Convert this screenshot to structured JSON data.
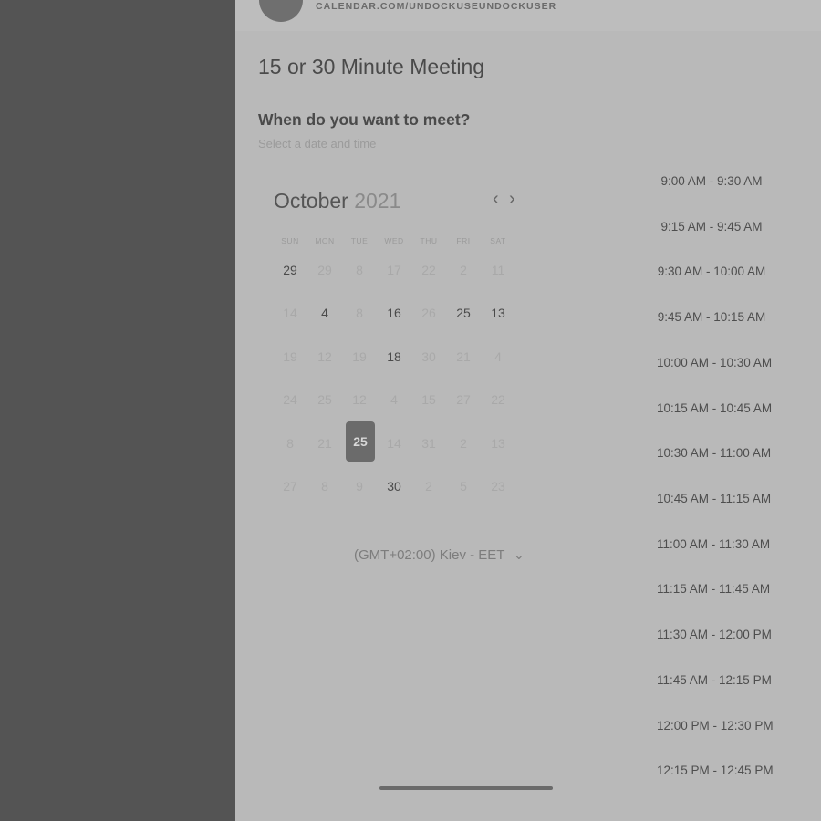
{
  "header": {
    "url": "CALENDAR.COM/UNDOCKUSEUNDOCKUSER"
  },
  "event": {
    "title": "15 or 30 Minute Meeting",
    "question": "When do you want to meet?",
    "subtitle": "Select a date and time"
  },
  "calendar": {
    "month": "October",
    "year": "2021",
    "prev_icon": "‹",
    "next_icon": "›",
    "weekdays": [
      "SUN",
      "MON",
      "TUE",
      "WED",
      "THU",
      "FRI",
      "SAT"
    ],
    "weeks": [
      [
        "29",
        "29",
        "8",
        "17",
        "22",
        "2",
        "11"
      ],
      [
        "14",
        "4",
        "8",
        "16",
        "26",
        "25",
        "13"
      ],
      [
        "19",
        "12",
        "19",
        "18",
        "30",
        "21",
        "4"
      ],
      [
        "24",
        "25",
        "12",
        "4",
        "15",
        "27",
        "22"
      ],
      [
        "8",
        "21",
        "25",
        "14",
        "31",
        "2",
        "13"
      ],
      [
        "27",
        "8",
        "9",
        "30",
        "2",
        "5",
        "23"
      ]
    ],
    "selected_day": "25"
  },
  "timezone": {
    "label": "(GMT+02:00) Kiev - EET",
    "chevron": "⌄"
  },
  "time_slots": [
    "9:00 AM - 9:30 AM",
    "9:15 AM - 9:45 AM",
    "9:30 AM - 10:00 AM",
    "9:45 AM - 10:15 AM",
    "10:00 AM - 10:30 AM",
    "10:15 AM - 10:45 AM",
    "10:30 AM - 11:00 AM",
    "10:45 AM - 11:15 AM",
    "11:00 AM - 11:30 AM",
    "11:15 AM - 11:45 AM",
    "11:30 AM - 12:00 PM",
    "11:45 AM - 12:15 PM",
    "12:00 PM - 12:30 PM",
    "12:15 PM - 12:45 PM"
  ]
}
